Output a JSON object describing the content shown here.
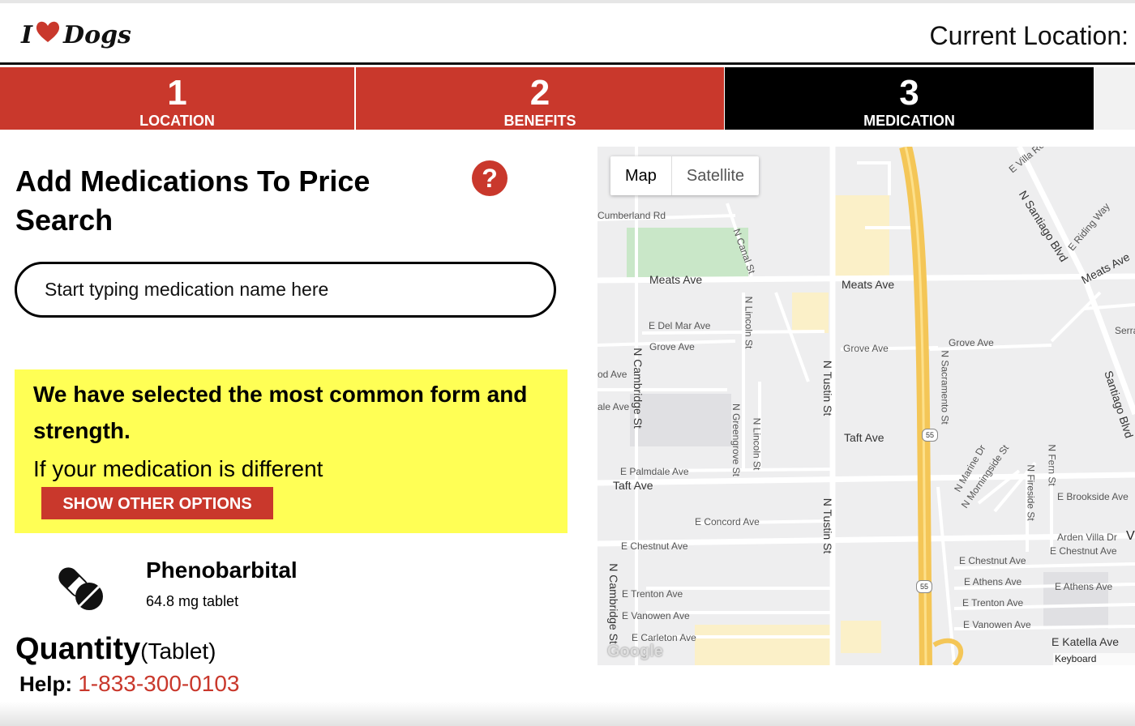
{
  "header": {
    "logo_text_i": "I",
    "logo_text_dogs": "Dogs",
    "current_location_label": "Current Location:"
  },
  "steps": [
    {
      "number": "1",
      "label": "LOCATION"
    },
    {
      "number": "2",
      "label": "BENEFITS"
    },
    {
      "number": "3",
      "label": "MEDICATION"
    }
  ],
  "panel": {
    "title": "Add Medications To Price Search",
    "help_icon": "?",
    "search_placeholder": "Start typing medication name here"
  },
  "notice": {
    "bold_text": "We have selected the most common form and strength.",
    "plain_text": "If your medication is different",
    "button_label": "SHOW OTHER OPTIONS"
  },
  "medication": {
    "icon": "pill-icon",
    "name": "Phenobarbital",
    "form": "64.8 mg tablet"
  },
  "quantity": {
    "label": "Quantity",
    "unit": "(Tablet)"
  },
  "help": {
    "label": "Help:",
    "phone": "1-833-300-0103"
  },
  "map": {
    "toggle_map": "Map",
    "toggle_satellite": "Satellite",
    "google_logo": "Google",
    "keyboard_shortcuts": "Keyboard shortcuts",
    "labels": {
      "cumberland": "Cumberland Rd",
      "meats_w": "Meats Ave",
      "meats_c": "Meats Ave",
      "meats_e": "Meats Ave",
      "del_mar": "E Del Mar Ave",
      "grove_w": "Grove Ave",
      "grove_c": "Grove Ave",
      "grove_e": "Grove Ave",
      "od_ave": "od Ave",
      "ale_ave": "ale Ave",
      "taft_c": "Taft Ave",
      "taft_w": "Taft Ave",
      "palmdale": "E Palmdale Ave",
      "concord": "E Concord Ave",
      "chestnut_w": "E Chestnut Ave",
      "chestnut_e1": "E Chestnut Ave",
      "chestnut_e2": "E Chestnut Ave",
      "trenton_w": "E Trenton Ave",
      "trenton_e": "E Trenton Ave",
      "vanowen_w": "E Vanowen Ave",
      "vanowen_e": "E Vanowen Ave",
      "carleton": "E Carleton Ave",
      "athens_1": "E Athens Ave",
      "athens_2": "E Athens Ave",
      "brookside": "E Brookside Ave",
      "arden": "Arden Villa Dr",
      "katella": "E Katella Ave",
      "serran": "Serran",
      "villa": "E Villa Ro",
      "riding": "E Riding Way",
      "santiago_n": "N Santiago Blvd",
      "santiago": "Santiago Blvd",
      "tustin_1": "N Tustin St",
      "tustin_2": "N Tustin St",
      "cambridge_1": "N Cambridge St",
      "cambridge_2": "N Cambridge St",
      "canal": "N Canal St",
      "lincoln_1": "N Lincoln St",
      "lincoln_2": "N Lincoln St",
      "greengrove": "N Greengrove St",
      "sacramento": "N Sacramento St",
      "marine": "N Marine Dr",
      "morningside": "N Morningside St",
      "fireside": "N Fireside St",
      "fern": "N Fern St",
      "hwy": "55",
      "v": "V"
    }
  }
}
